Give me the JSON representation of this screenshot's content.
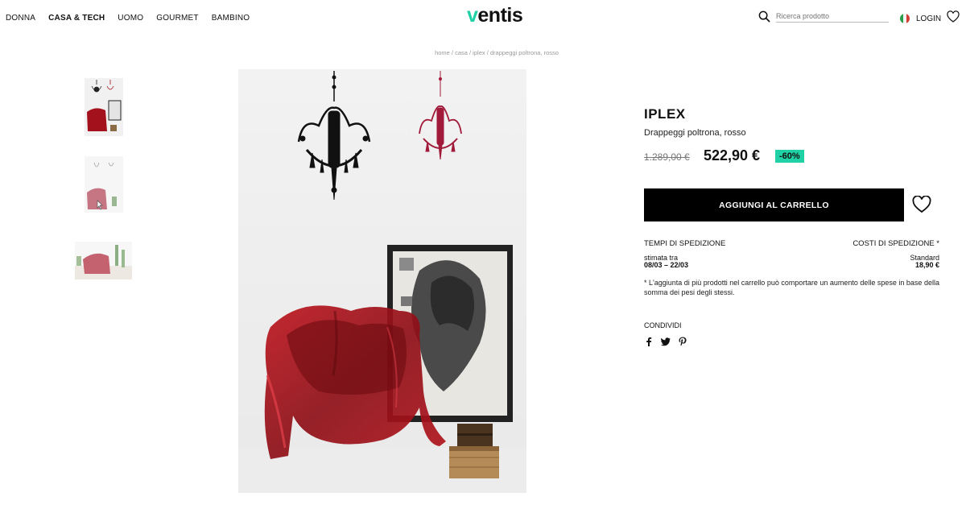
{
  "nav": {
    "items": [
      "DONNA",
      "CASA & TECH",
      "UOMO",
      "GOURMET",
      "BAMBINO"
    ]
  },
  "logo": {
    "v": "v",
    "rest": "entis"
  },
  "search": {
    "placeholder": "Ricerca prodotto"
  },
  "header": {
    "login": "LOGIN"
  },
  "breadcrumb": "home / casa / iplex / drappeggi poltrona, rosso",
  "product": {
    "brand": "IPLEX",
    "name": "Drappeggi poltrona, rosso",
    "old_price": "1.289,00 €",
    "new_price": "522,90 €",
    "discount": "-60%",
    "add_to_cart": "AGGIUNGI AL CARRELLO"
  },
  "shipping": {
    "times_title": "TEMPI DI SPEDIZIONE",
    "cost_title": "COSTI DI SPEDIZIONE *",
    "eta_label": "stimata tra",
    "eta_dates": "08/03 – 22/03",
    "std_label": "Standard",
    "std_price": "18,90 €",
    "note": "* L'aggiunta di più prodotti nel carrello può comportare un aumento delle spese in base della somma dei pesi degli stessi."
  },
  "share": {
    "title": "CONDIVIDI",
    "icons": [
      "facebook-icon",
      "twitter-icon",
      "pinterest-icon"
    ]
  },
  "colors": {
    "accent": "#1fd1a5",
    "chair_red": "#a3121c",
    "button_black": "#000000"
  }
}
